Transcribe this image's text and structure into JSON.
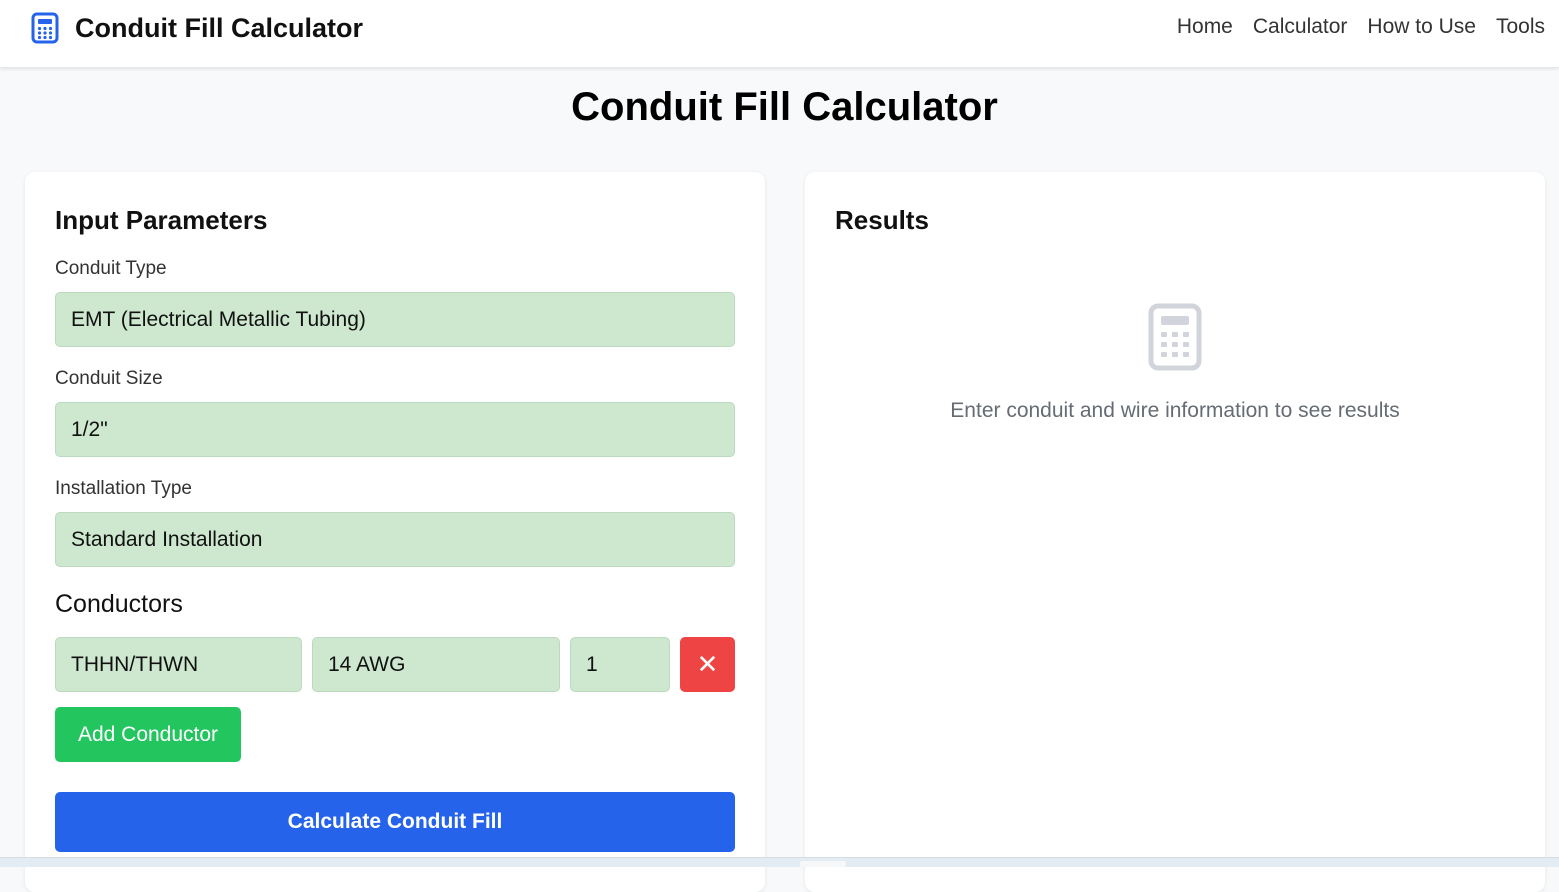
{
  "app": {
    "brand_title": "Conduit Fill Calculator",
    "brand_icon": "calculator-icon",
    "accent_color": "#2563eb"
  },
  "nav": {
    "items": [
      "Home",
      "Calculator",
      "How to Use",
      "Tools"
    ]
  },
  "page": {
    "title": "Conduit Fill Calculator"
  },
  "input_panel": {
    "heading": "Input Parameters",
    "conduit_type": {
      "label": "Conduit Type",
      "value": "EMT (Electrical Metallic Tubing)"
    },
    "conduit_size": {
      "label": "Conduit Size",
      "value": "1/2\""
    },
    "installation_type": {
      "label": "Installation Type",
      "value": "Standard Installation"
    },
    "conductors_heading": "Conductors",
    "conductors": [
      {
        "type": "THHN/THWN",
        "size": "14 AWG",
        "quantity": "1",
        "remove_icon": "close-icon"
      }
    ],
    "add_button": "Add Conductor",
    "calculate_button": "Calculate Conduit Fill",
    "field_color": "#cde8cf",
    "add_button_color": "#22c55e",
    "remove_button_color": "#ef4444",
    "calculate_button_color": "#2563eb"
  },
  "results_panel": {
    "heading": "Results",
    "placeholder_icon": "calculator-icon",
    "placeholder_text": "Enter conduit and wire information to see results"
  }
}
